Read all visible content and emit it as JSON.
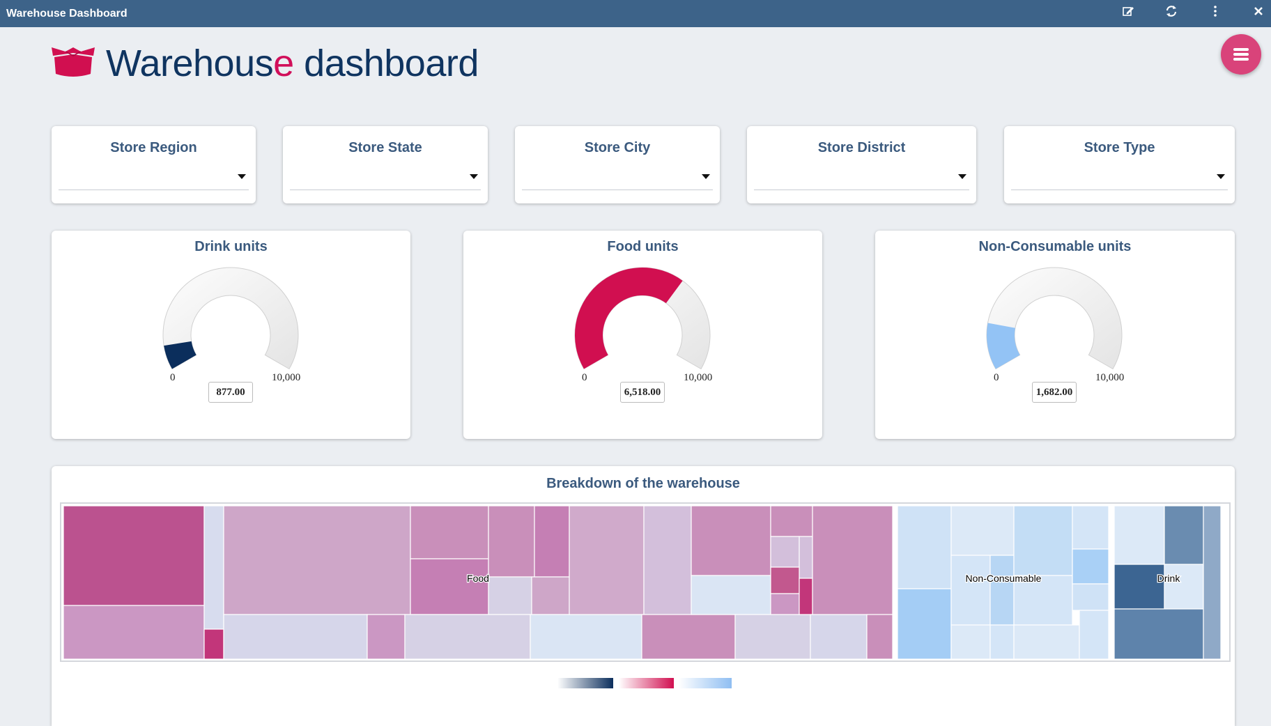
{
  "window": {
    "title": "Warehouse Dashboard",
    "buttons": [
      "edit-icon",
      "refresh-icon",
      "more-vert-icon",
      "close-icon"
    ]
  },
  "header": {
    "title_part1": "Warehous",
    "title_part2": "e",
    "title_part3": " dashboard",
    "logo": "box-icon",
    "menu_button": "hamburger-icon"
  },
  "filters": [
    {
      "label": "Store Region",
      "value": ""
    },
    {
      "label": "Store State",
      "value": ""
    },
    {
      "label": "Store City",
      "value": ""
    },
    {
      "label": "Store District",
      "value": ""
    },
    {
      "label": "Store Type",
      "value": ""
    }
  ],
  "gauges": [
    {
      "title": "Drink units",
      "value": 877,
      "value_label": "877.00",
      "min": 0,
      "max": 10000,
      "min_label": "0",
      "max_label": "10,000",
      "color": "#0b2e5c"
    },
    {
      "title": "Food units",
      "value": 6518,
      "value_label": "6,518.00",
      "min": 0,
      "max": 10000,
      "min_label": "0",
      "max_label": "10,000",
      "color": "#d10f50"
    },
    {
      "title": "Non-Consumable units",
      "value": 1682,
      "value_label": "1,682.00",
      "min": 0,
      "max": 10000,
      "min_label": "0",
      "max_label": "10,000",
      "color": "#93c3f5"
    }
  ],
  "breakdown": {
    "title": "Breakdown of the warehouse",
    "groups": [
      {
        "name": "Food",
        "color": "#c2367a"
      },
      {
        "name": "Non-Consumable",
        "color": "#8fbef2"
      },
      {
        "name": "Drink",
        "color": "#2f5c8c"
      }
    ],
    "legend_colors": [
      [
        "#ffffff",
        "#0b2e5c"
      ],
      [
        "#ffffff",
        "#d10f50"
      ],
      [
        "#ffffff",
        "#8fbef2"
      ]
    ]
  }
}
